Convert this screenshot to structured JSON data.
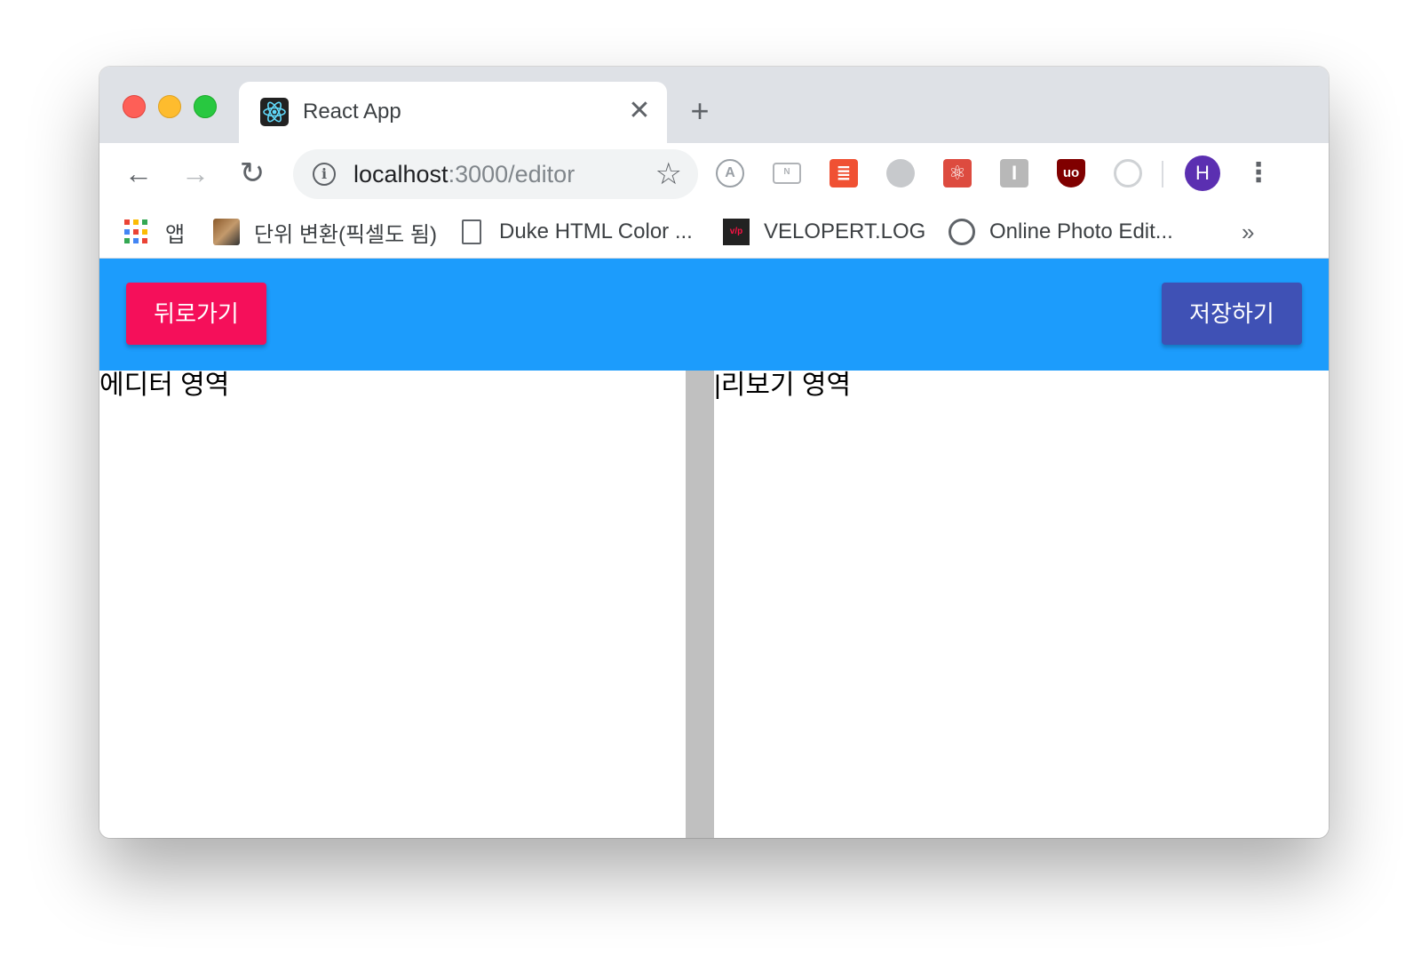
{
  "browser": {
    "tab": {
      "title": "React App",
      "close_glyph": "✕",
      "favicon": "react-logo-icon"
    },
    "new_tab_glyph": "+",
    "nav": {
      "back_glyph": "←",
      "forward_glyph": "→",
      "reload_glyph": "↻"
    },
    "address": {
      "host": "localhost",
      "path": ":3000/editor",
      "info_glyph": "i",
      "star_glyph": "☆"
    },
    "extensions": [
      {
        "name": "a-circle-icon",
        "glyph": "A"
      },
      {
        "name": "n-box-icon",
        "glyph": "N"
      },
      {
        "name": "list-icon",
        "glyph": "≣"
      },
      {
        "name": "brain-icon",
        "glyph": ""
      },
      {
        "name": "react-devtools-icon",
        "glyph": "⚛"
      },
      {
        "name": "i-box-icon",
        "glyph": "I"
      },
      {
        "name": "ublock-icon",
        "glyph": "uo"
      },
      {
        "name": "ring-icon",
        "glyph": ""
      }
    ],
    "profile_initial": "H",
    "menu_glyph": "⋮",
    "bookmarks": [
      {
        "label": "앱",
        "icon": "apps-grid-icon"
      },
      {
        "label": "단위 변환(픽셀도 됨)",
        "icon": "tc-icon"
      },
      {
        "label": "Duke HTML Color ...",
        "icon": "page-icon"
      },
      {
        "label": "VELOPERT.LOG",
        "icon": "velopert-icon"
      },
      {
        "label": "Online Photo Edit...",
        "icon": "aperture-icon"
      }
    ],
    "bookmarks_more": "»"
  },
  "app": {
    "back_button": "뒤로가기",
    "save_button": "저장하기",
    "editor_label": "에디터 영역",
    "preview_label": "|리보기 영역"
  },
  "colors": {
    "header_bg": "#1c9cfc",
    "back_button_bg": "#f50f5a",
    "save_button_bg": "#3f51b5",
    "splitter": "#c0c0c0"
  }
}
